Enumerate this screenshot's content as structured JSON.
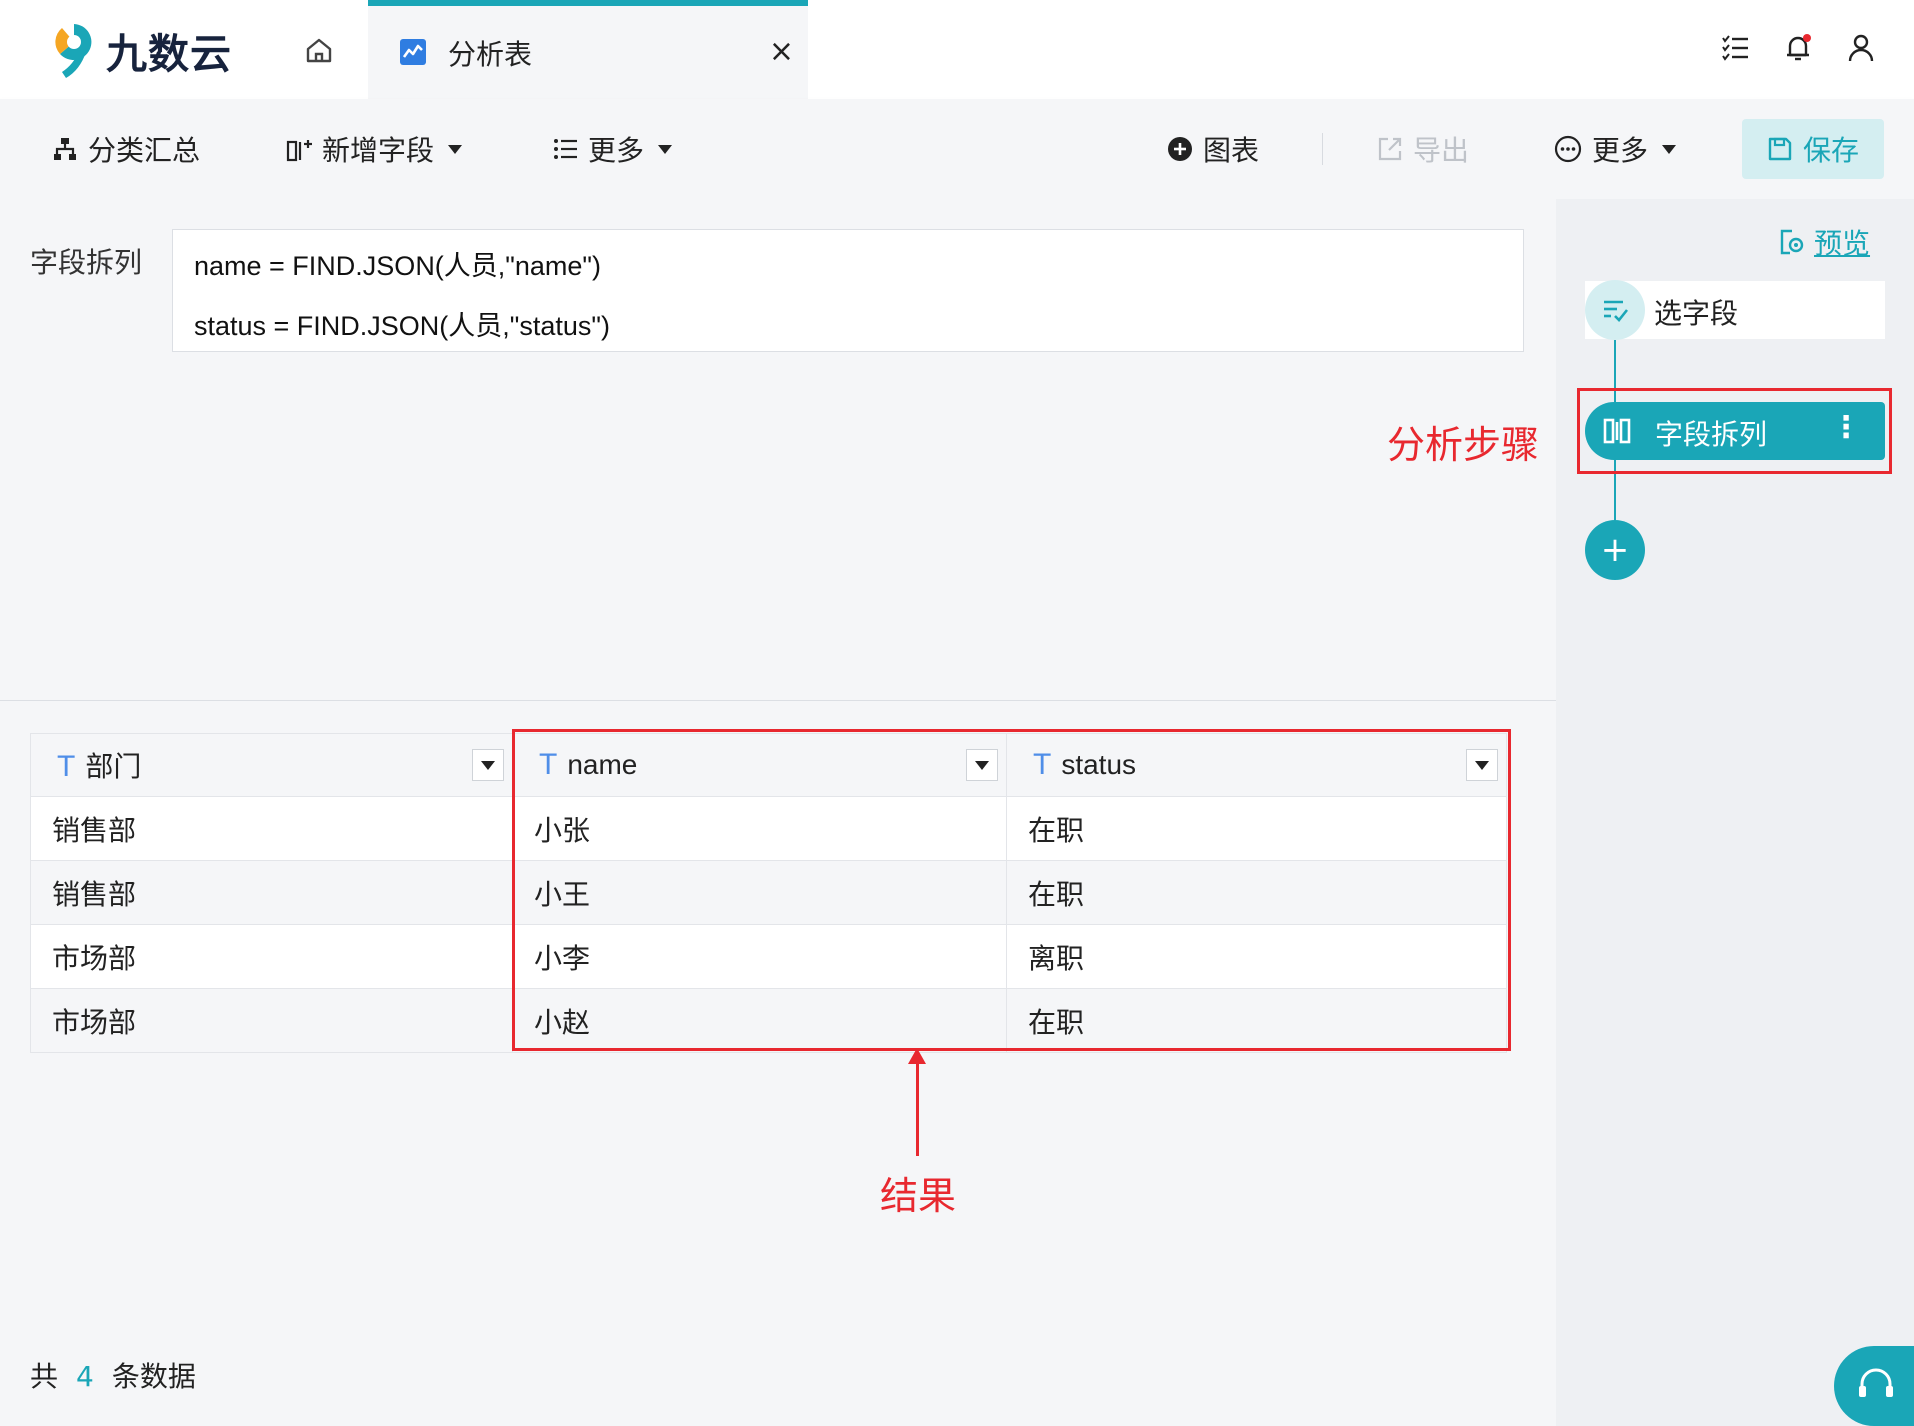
{
  "app": {
    "name": "九数云"
  },
  "tabs": {
    "home_icon": "home-icon",
    "active": {
      "title": "分析表",
      "icon": "chart-icon",
      "close": "×"
    }
  },
  "header_icons": [
    "task-list-icon",
    "bell-icon",
    "user-icon"
  ],
  "colors": {
    "accent": "#1aa6b7",
    "annotation": "#e8282f",
    "type_icon": "#4f8ee8"
  },
  "toolbar": {
    "group_summary": "分类汇总",
    "add_field": "新增字段",
    "more_left": "更多",
    "chart": "图表",
    "export": "导出",
    "more_right": "更多",
    "save": "保存"
  },
  "editor": {
    "label": "字段拆列",
    "formulas": [
      "name = FIND.JSON(人员,\"name\")",
      "status = FIND.JSON(人员,\"status\")"
    ]
  },
  "table": {
    "columns": [
      {
        "type": "T",
        "name": "部门"
      },
      {
        "type": "T",
        "name": "name"
      },
      {
        "type": "T",
        "name": "status"
      }
    ],
    "rows": [
      [
        "销售部",
        "小张",
        "在职"
      ],
      [
        "销售部",
        "小王",
        "在职"
      ],
      [
        "市场部",
        "小李",
        "离职"
      ],
      [
        "市场部",
        "小赵",
        "在职"
      ]
    ]
  },
  "footer": {
    "prefix": "共",
    "count": "4",
    "suffix": "条数据"
  },
  "steps_panel": {
    "preview": "预览",
    "steps": [
      {
        "label": "选字段",
        "active": false
      },
      {
        "label": "字段拆列",
        "active": true,
        "menu": "⋮"
      }
    ],
    "add": "+"
  },
  "annotations": {
    "steps": "分析步骤",
    "result": "结果"
  }
}
